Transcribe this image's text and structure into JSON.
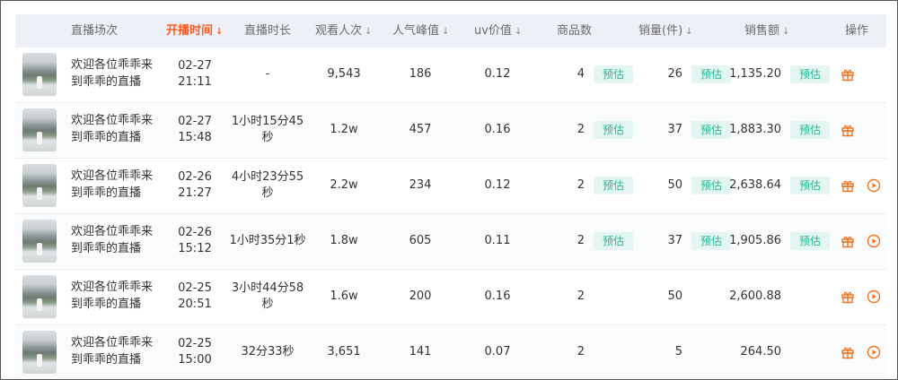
{
  "columns": {
    "session": "直播场次",
    "start_time": "开播时间",
    "duration": "直播时长",
    "views": "观看人次",
    "peak": "人气峰值",
    "uv": "uv价值",
    "products": "商品数",
    "sales_count": "销量(件)",
    "sales_amount": "销售额",
    "actions": "操作"
  },
  "sort_arrow": "↓",
  "estimate_label": "预估",
  "colors": {
    "accent_orange": "#ff5a1f",
    "badge_bg": "#e3f6f1",
    "badge_text": "#2bb594",
    "header_bg": "#edf1f7"
  },
  "icons": {
    "detail": "gift-icon",
    "replay": "play-circle-icon"
  },
  "rows": [
    {
      "title": "欢迎各位乖乖来到乖乖的直播",
      "date": "02-27",
      "time": "21:11",
      "duration": "-",
      "views": "9,543",
      "peak": "186",
      "uv": "0.12",
      "products": "4",
      "products_est": true,
      "sales_count": "26",
      "sales_count_est": true,
      "sales_amount": "1,135.20",
      "sales_amount_est": true,
      "has_replay": false
    },
    {
      "title": "欢迎各位乖乖来到乖乖的直播",
      "date": "02-27",
      "time": "15:48",
      "duration": "1小时15分45秒",
      "views": "1.2w",
      "peak": "457",
      "uv": "0.16",
      "products": "2",
      "products_est": true,
      "sales_count": "37",
      "sales_count_est": true,
      "sales_amount": "1,883.30",
      "sales_amount_est": true,
      "has_replay": false
    },
    {
      "title": "欢迎各位乖乖来到乖乖的直播",
      "date": "02-26",
      "time": "21:27",
      "duration": "4小时23分55秒",
      "views": "2.2w",
      "peak": "234",
      "uv": "0.12",
      "products": "2",
      "products_est": true,
      "sales_count": "50",
      "sales_count_est": true,
      "sales_amount": "2,638.64",
      "sales_amount_est": true,
      "has_replay": true
    },
    {
      "title": "欢迎各位乖乖来到乖乖的直播",
      "date": "02-26",
      "time": "15:12",
      "duration": "1小时35分1秒",
      "views": "1.8w",
      "peak": "605",
      "uv": "0.11",
      "products": "2",
      "products_est": true,
      "sales_count": "37",
      "sales_count_est": true,
      "sales_amount": "1,905.86",
      "sales_amount_est": true,
      "has_replay": true
    },
    {
      "title": "欢迎各位乖乖来到乖乖的直播",
      "date": "02-25",
      "time": "20:51",
      "duration": "3小时44分58秒",
      "views": "1.6w",
      "peak": "200",
      "uv": "0.16",
      "products": "2",
      "products_est": false,
      "sales_count": "50",
      "sales_count_est": false,
      "sales_amount": "2,600.88",
      "sales_amount_est": false,
      "has_replay": true
    },
    {
      "title": "欢迎各位乖乖来到乖乖的直播",
      "date": "02-25",
      "time": "15:00",
      "duration": "32分33秒",
      "views": "3,651",
      "peak": "141",
      "uv": "0.07",
      "products": "2",
      "products_est": false,
      "sales_count": "5",
      "sales_count_est": false,
      "sales_amount": "264.50",
      "sales_amount_est": false,
      "has_replay": true
    }
  ]
}
